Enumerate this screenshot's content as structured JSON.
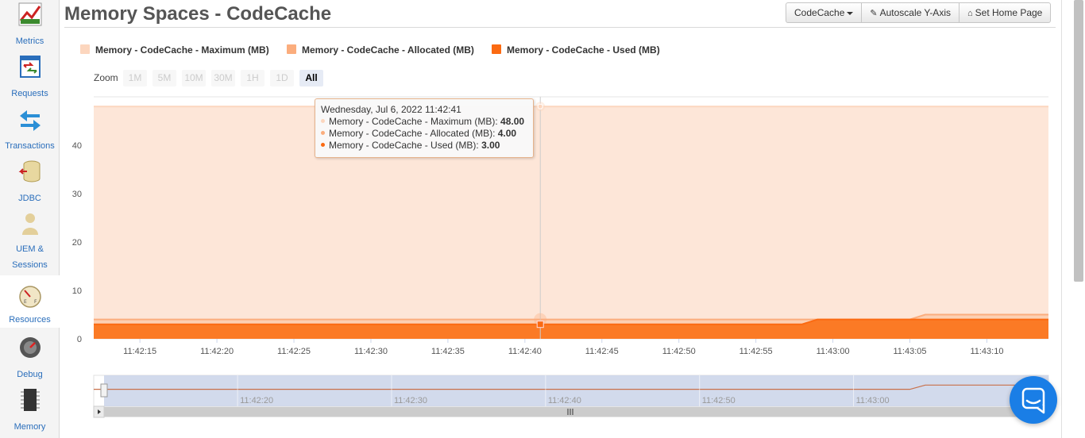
{
  "sidebar": {
    "items": [
      {
        "label": "Metrics",
        "icon": "chart-icon"
      },
      {
        "label": "Requests",
        "icon": "requests-icon"
      },
      {
        "label": "Transactions",
        "icon": "transactions-icon"
      },
      {
        "label": "JDBC",
        "icon": "database-icon"
      },
      {
        "label_line1": "UEM &",
        "label_line2": "Sessions",
        "icon": "user-icon"
      },
      {
        "label": "Resources",
        "icon": "gauge-icon",
        "active": true
      },
      {
        "label": "Debug",
        "icon": "debug-icon"
      },
      {
        "label": "Memory",
        "icon": "memory-chip-icon"
      }
    ]
  },
  "header": {
    "title": "Memory Spaces - CodeCache",
    "buttons": {
      "selector": "CodeCache",
      "autoscale": "Autoscale Y-Axis",
      "home": "Set Home Page"
    }
  },
  "zoom": {
    "label": "Zoom",
    "options": [
      "1M",
      "5M",
      "10M",
      "30M",
      "1H",
      "1D",
      "All"
    ],
    "selected": "All"
  },
  "colors": {
    "maximum": "#fcd6be",
    "allocated": "#fbad7d",
    "used": "#fb6a12",
    "accent": "#2a6ebb"
  },
  "tooltip": {
    "header": "Wednesday, Jul 6, 2022 11:42:41",
    "rows": [
      {
        "label": "Memory - CodeCache - Maximum (MB):",
        "value": "48.00"
      },
      {
        "label": "Memory - CodeCache - Allocated (MB):",
        "value": "4.00"
      },
      {
        "label": "Memory - CodeCache - Used (MB):",
        "value": "3.00"
      }
    ]
  },
  "chart_data": {
    "type": "area",
    "x_start": "11:42:12",
    "x_end": "11:43:14",
    "x_ticks": [
      "11:42:15",
      "11:42:20",
      "11:42:25",
      "11:42:30",
      "11:42:35",
      "11:42:40",
      "11:42:45",
      "11:42:50",
      "11:42:55",
      "11:43:00",
      "11:43:05",
      "11:43:10"
    ],
    "ylim": [
      0,
      48
    ],
    "y_ticks": [
      0,
      10,
      20,
      30,
      40
    ],
    "grid": true,
    "legend_position": "top-left",
    "series": [
      {
        "name": "Memory - CodeCache - Maximum (MB)",
        "points": [
          [
            "11:42:12",
            48
          ],
          [
            "11:43:14",
            48
          ]
        ]
      },
      {
        "name": "Memory - CodeCache - Allocated (MB)",
        "points": [
          [
            "11:42:12",
            4
          ],
          [
            "11:43:05",
            4
          ],
          [
            "11:43:06",
            5
          ],
          [
            "11:43:14",
            5
          ]
        ]
      },
      {
        "name": "Memory - CodeCache - Used (MB)",
        "points": [
          [
            "11:42:12",
            3
          ],
          [
            "11:42:58",
            3
          ],
          [
            "11:42:59",
            4
          ],
          [
            "11:43:14",
            4
          ]
        ]
      }
    ],
    "hover_time": "11:42:41",
    "navigator_ticks": [
      "11:42:20",
      "11:42:30",
      "11:42:40",
      "11:42:50",
      "11:43:00"
    ]
  }
}
